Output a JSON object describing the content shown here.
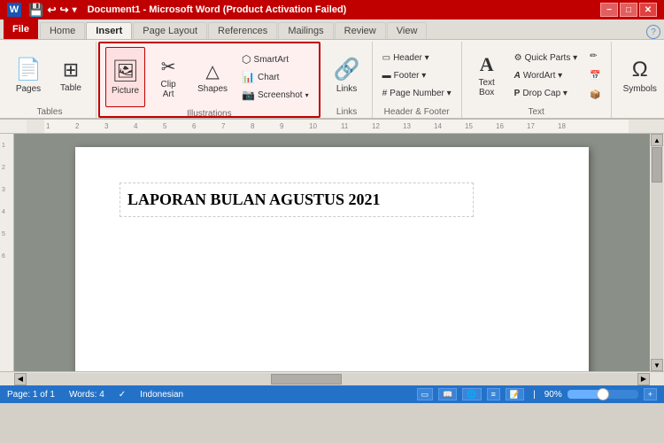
{
  "titlebar": {
    "title": "Document1 - Microsoft Word (Product Activation Failed)",
    "controls": [
      "minimize",
      "restore",
      "close"
    ]
  },
  "menubar": {
    "file_label": "File",
    "tabs": [
      "Home",
      "Insert",
      "Page Layout",
      "References",
      "Mailings",
      "Review",
      "View"
    ]
  },
  "ribbon": {
    "active_tab": "Insert",
    "groups": [
      {
        "name": "tables",
        "label": "Tables",
        "buttons": [
          {
            "id": "pages",
            "label": "Pages",
            "icon": "📄"
          },
          {
            "id": "table",
            "label": "Table",
            "icon": "⊞"
          }
        ]
      },
      {
        "name": "illustrations",
        "label": "Illustrations",
        "highlighted": true,
        "buttons": [
          {
            "id": "picture",
            "label": "Picture",
            "icon": "🖼"
          },
          {
            "id": "clipart",
            "label": "Clip\nArt",
            "icon": "✂"
          },
          {
            "id": "shapes",
            "label": "Shapes",
            "icon": "△"
          }
        ],
        "stack_buttons": [
          {
            "id": "smartart",
            "label": "SmartArt",
            "icon": "⬡"
          },
          {
            "id": "chart",
            "label": "Chart",
            "icon": "📊"
          },
          {
            "id": "screenshot",
            "label": "Screenshot",
            "icon": "📷",
            "has_arrow": true
          }
        ]
      },
      {
        "name": "links",
        "label": "Links",
        "buttons": [
          {
            "id": "links",
            "label": "Links",
            "icon": "🔗"
          }
        ]
      },
      {
        "name": "header_footer",
        "label": "Header & Footer",
        "stack_buttons": [
          {
            "id": "header",
            "label": "Header ▾",
            "icon": "▭"
          },
          {
            "id": "footer",
            "label": "Footer ▾",
            "icon": "▬"
          },
          {
            "id": "pagenumber",
            "label": "Page Number ▾",
            "icon": "#"
          }
        ]
      },
      {
        "name": "text",
        "label": "Text",
        "buttons": [
          {
            "id": "textbox",
            "label": "Text\nBox",
            "icon": "T"
          }
        ],
        "stack_buttons": [
          {
            "id": "quickparts",
            "label": "Quick Parts ▾",
            "icon": "⚙"
          },
          {
            "id": "wordart",
            "label": "WordArt ▾",
            "icon": "A"
          },
          {
            "id": "dropcap",
            "label": "Drop Cap ▾",
            "icon": "P"
          }
        ]
      },
      {
        "name": "symbols",
        "label": "",
        "buttons": [
          {
            "id": "symbols",
            "label": "Symbols",
            "icon": "Ω"
          }
        ]
      }
    ]
  },
  "document": {
    "content": "LAPORAN BULAN AGUSTUS 2021",
    "cursor_visible": true
  },
  "statusbar": {
    "page_info": "Page: 1 of 1",
    "words": "Words: 4",
    "language": "Indonesian",
    "zoom": "90%"
  }
}
